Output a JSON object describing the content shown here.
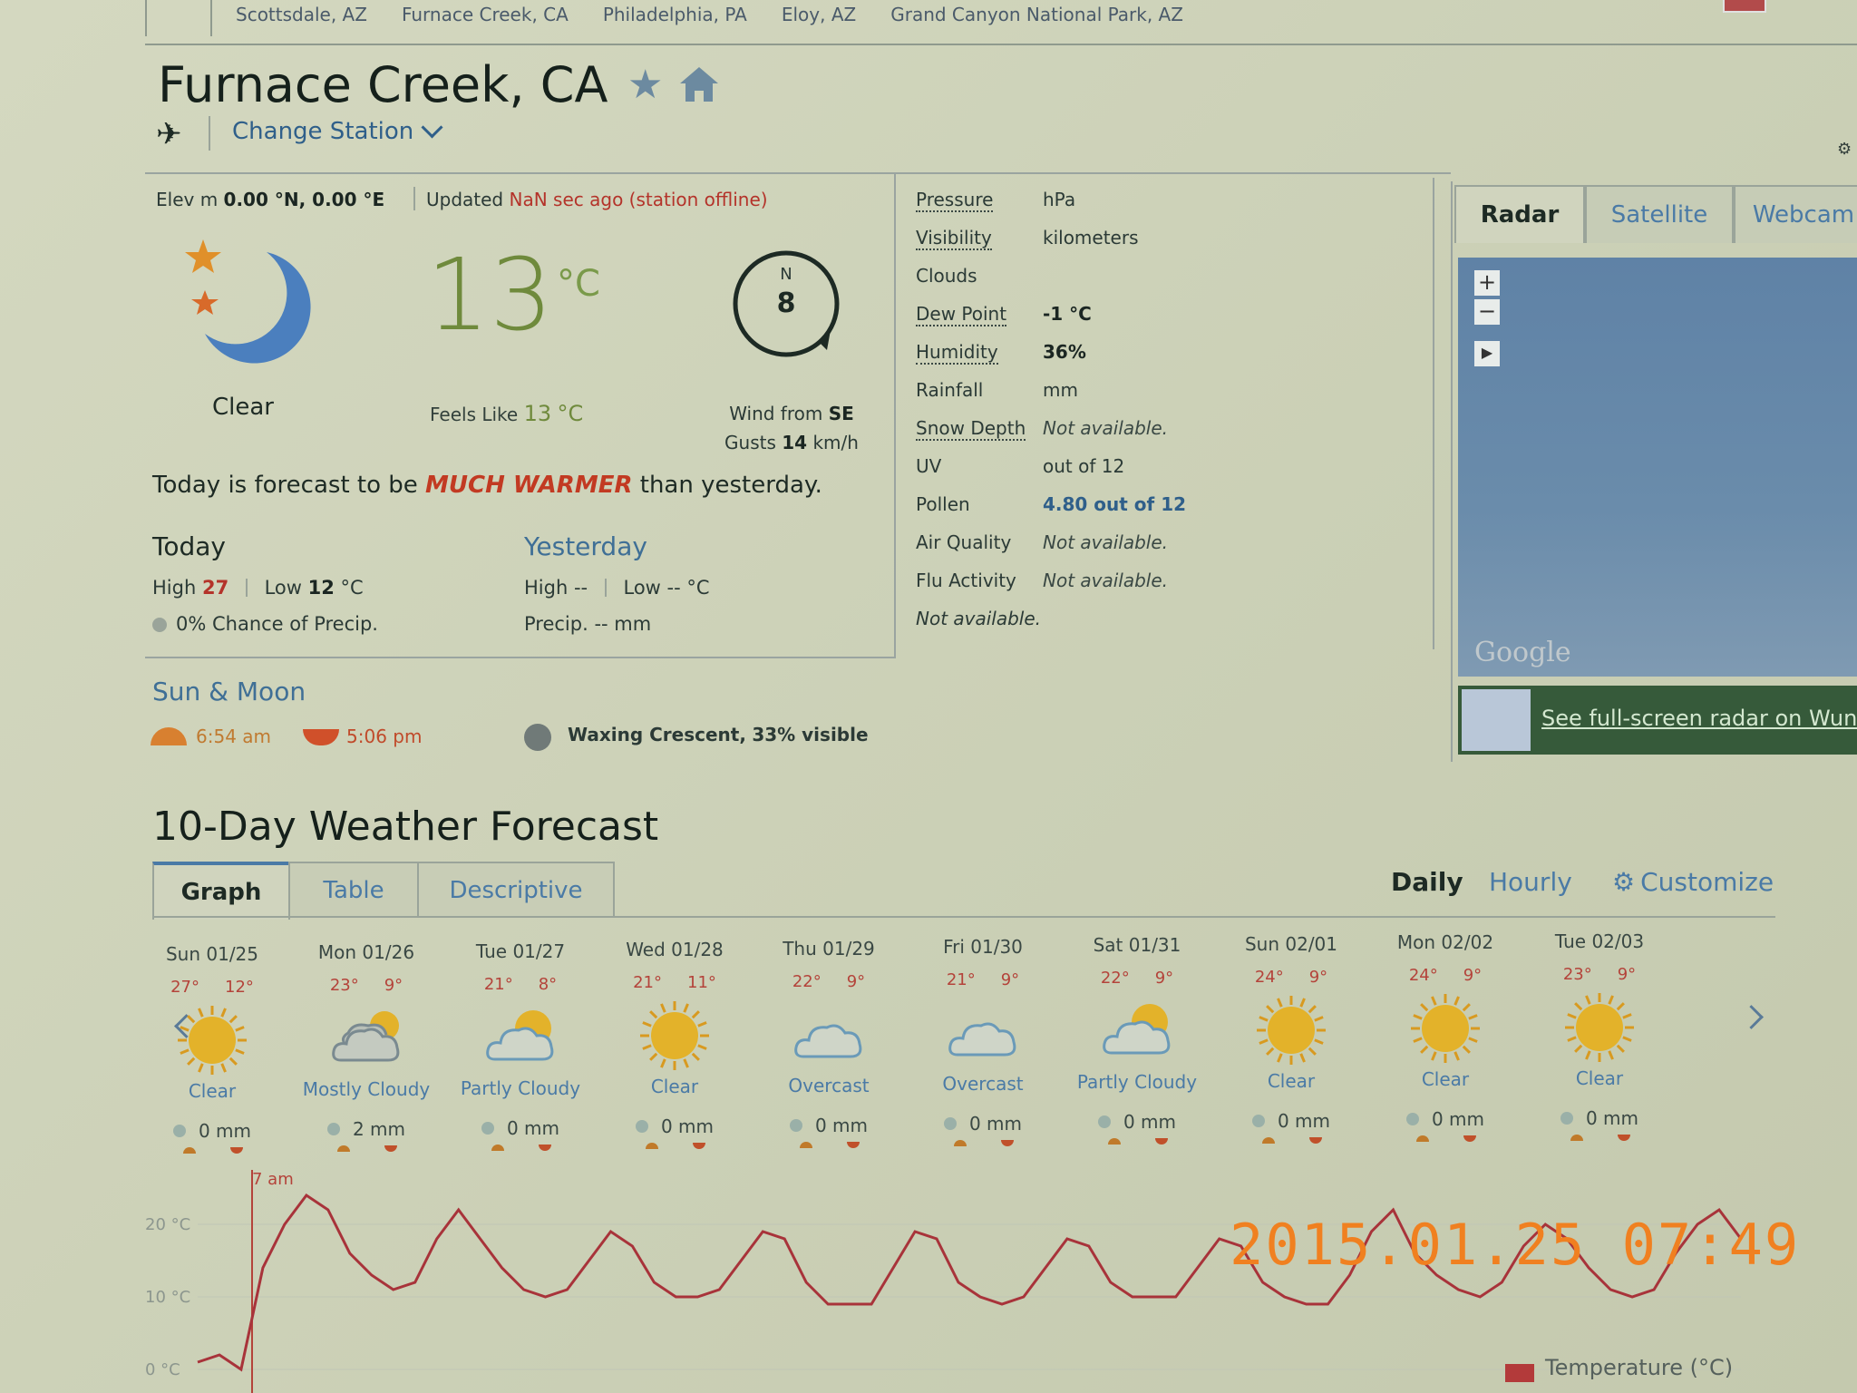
{
  "recent_stations": [
    "Scottsdale, AZ",
    "Furnace Creek, CA",
    "Philadelphia, PA",
    "Eloy, AZ",
    "Grand Canyon National Park, AZ"
  ],
  "header": {
    "city": "Furnace Creek, CA",
    "change_station": "Change Station"
  },
  "station": {
    "elev_label": "Elev",
    "elev_unit": "m",
    "coords": "0.00 °N, 0.00 °E",
    "updated_prefix": "Updated",
    "updated_value": "NaN sec ago (station offline)"
  },
  "current": {
    "condition": "Clear",
    "temp": "13",
    "temp_unit": "°C",
    "feels_label": "Feels Like",
    "feels_value": "13",
    "feels_unit": "°C",
    "wind_dir_letter": "N",
    "wind_speed": "8",
    "wind_from_label": "Wind from",
    "wind_from_value": "SE",
    "gusts_label": "Gusts",
    "gusts_value": "14",
    "gusts_unit": "km/h"
  },
  "forecast_sentence": {
    "prefix": "Today is forecast to be",
    "emph": "MUCH WARMER",
    "suffix": "than yesterday."
  },
  "today": {
    "title": "Today",
    "high_label": "High",
    "high": "27",
    "low_label": "Low",
    "low": "12",
    "unit": "°C",
    "precip": "0% Chance of Precip."
  },
  "yesterday": {
    "title": "Yesterday",
    "high_label": "High",
    "high": "--",
    "low_label": "Low",
    "low": "--",
    "unit": "°C",
    "precip": "Precip. -- mm"
  },
  "sun_moon": {
    "title": "Sun & Moon",
    "sunrise": "6:54 am",
    "sunset": "5:06 pm",
    "moon_phase": "Waxing Crescent,",
    "moon_visible": "33% visible"
  },
  "conditions": [
    {
      "label": "Pressure",
      "value": "hPa"
    },
    {
      "label": "Visibility",
      "value": "kilometers"
    },
    {
      "label": "Clouds",
      "value": ""
    },
    {
      "label": "Dew Point",
      "value": "-1 °C"
    },
    {
      "label": "Humidity",
      "value": "36%"
    },
    {
      "label": "Rainfall",
      "value": "mm"
    },
    {
      "label": "Snow Depth",
      "value": "Not available."
    },
    {
      "label": "UV",
      "value": "out of 12"
    },
    {
      "label": "Pollen",
      "value": "4.80 out of 12"
    },
    {
      "label": "Air Quality",
      "value": "Not available."
    },
    {
      "label": "Flu Activity",
      "value": "Not available."
    }
  ],
  "conditions_footer": "Not available.",
  "radar": {
    "tabs": [
      "Radar",
      "Satellite",
      "Webcam"
    ],
    "zoom_in": "+",
    "zoom_out": "−",
    "play": "▶",
    "map_attribution": "Google",
    "link": "See full-screen radar on Wun"
  },
  "ten_day": {
    "title": "10-Day Weather Forecast",
    "tabs": [
      "Graph",
      "Table",
      "Descriptive"
    ],
    "mode_daily": "Daily",
    "mode_hourly": "Hourly",
    "customize": "Customize",
    "days": [
      {
        "date": "Sun 01/25",
        "hi": "27°",
        "lo": "12°",
        "cond": "Clear",
        "icon": "sun-icon",
        "precip": "0 mm"
      },
      {
        "date": "Mon 01/26",
        "hi": "23°",
        "lo": "9°",
        "cond": "Mostly Cloudy",
        "icon": "mostly-cloudy-icon",
        "precip": "2 mm"
      },
      {
        "date": "Tue 01/27",
        "hi": "21°",
        "lo": "8°",
        "cond": "Partly Cloudy",
        "icon": "partly-cloudy-icon",
        "precip": "0 mm"
      },
      {
        "date": "Wed 01/28",
        "hi": "21°",
        "lo": "11°",
        "cond": "Clear",
        "icon": "sun-icon",
        "precip": "0 mm"
      },
      {
        "date": "Thu 01/29",
        "hi": "22°",
        "lo": "9°",
        "cond": "Overcast",
        "icon": "cloud-icon",
        "precip": "0 mm"
      },
      {
        "date": "Fri 01/30",
        "hi": "21°",
        "lo": "9°",
        "cond": "Overcast",
        "icon": "cloud-icon",
        "precip": "0 mm"
      },
      {
        "date": "Sat 01/31",
        "hi": "22°",
        "lo": "9°",
        "cond": "Partly Cloudy",
        "icon": "partly-cloudy-icon",
        "precip": "0 mm"
      },
      {
        "date": "Sun 02/01",
        "hi": "24°",
        "lo": "9°",
        "cond": "Clear",
        "icon": "sun-icon",
        "precip": "0 mm"
      },
      {
        "date": "Mon 02/02",
        "hi": "24°",
        "lo": "9°",
        "cond": "Clear",
        "icon": "sun-icon",
        "precip": "0 mm"
      },
      {
        "date": "Tue 02/03",
        "hi": "23°",
        "lo": "9°",
        "cond": "Clear",
        "icon": "sun-icon",
        "precip": "0 mm"
      }
    ],
    "now_marker": "7 am"
  },
  "chart_data": {
    "type": "line",
    "y_ticks": [
      "20 °C",
      "10 °C",
      "0 °C"
    ],
    "ylim": [
      0,
      25
    ],
    "legend": "Temperature (°C)",
    "series": [
      {
        "name": "Temperature (°C)",
        "values": [
          1,
          2,
          0,
          14,
          20,
          24,
          22,
          16,
          13,
          11,
          12,
          18,
          22,
          18,
          14,
          11,
          10,
          11,
          15,
          19,
          17,
          12,
          10,
          10,
          11,
          15,
          19,
          18,
          12,
          9,
          9,
          9,
          14,
          19,
          18,
          12,
          10,
          9,
          10,
          14,
          18,
          17,
          12,
          10,
          10,
          10,
          14,
          18,
          17,
          12,
          10,
          9,
          9,
          13,
          19,
          22,
          16,
          13,
          11,
          10,
          12,
          17,
          20,
          18,
          14,
          11,
          10,
          11,
          16,
          20,
          22,
          18
        ]
      }
    ]
  },
  "camera_stamp": "2015.01.25  07:49"
}
